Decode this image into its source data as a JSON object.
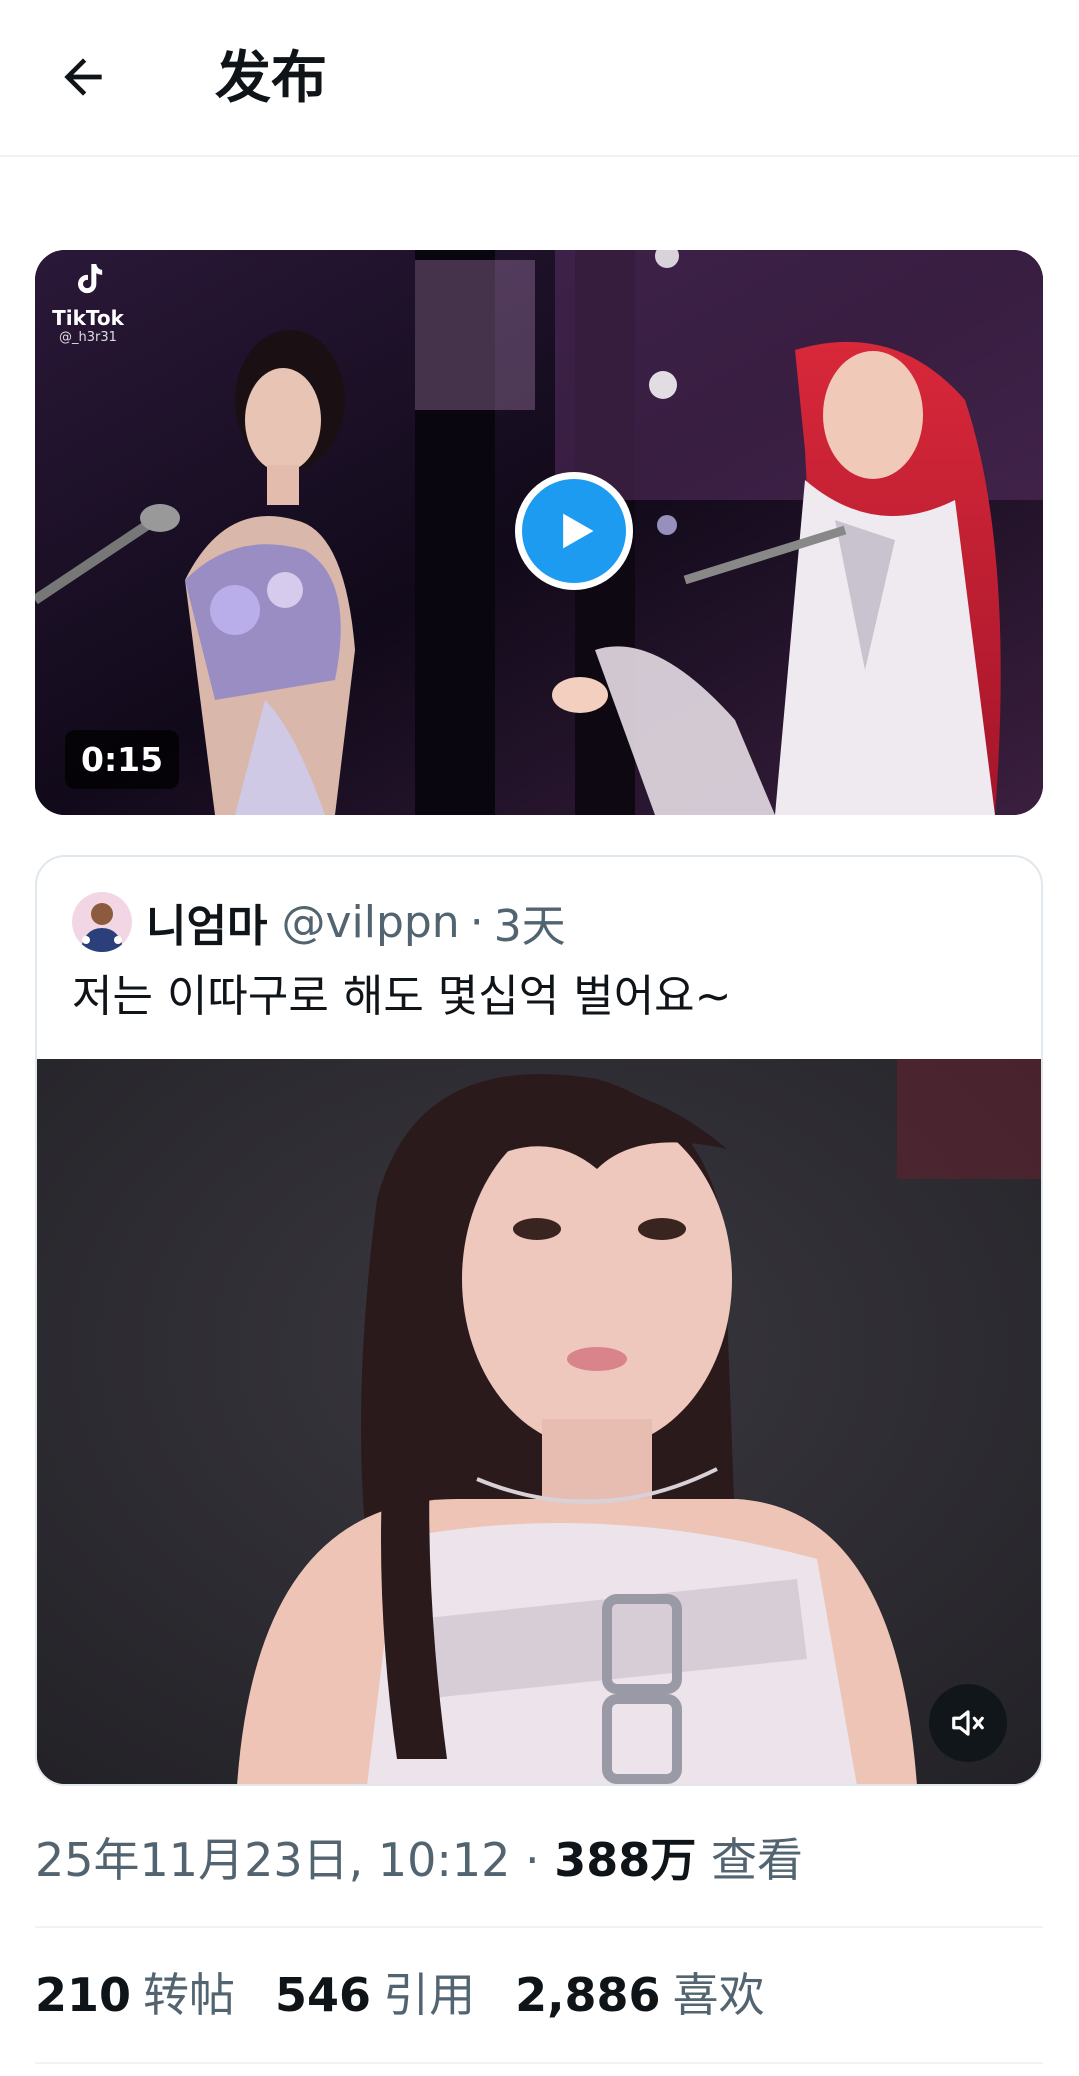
{
  "header": {
    "title": "发布"
  },
  "media": {
    "duration": "0:15",
    "watermark_brand": "TikTok",
    "watermark_user": "@_h3r31"
  },
  "quote": {
    "name": "니엄마",
    "handle": "@vilppn",
    "separator": "·",
    "time": "3天",
    "text": "저는 이따구로 해도 몇십억 벌어요~"
  },
  "meta": {
    "datetime": "25年11月23日, 10:12",
    "separator": "·",
    "views_count": "388万",
    "views_label": "查看"
  },
  "stats": {
    "reposts_count": "210",
    "reposts_label": "转帖",
    "quotes_count": "546",
    "quotes_label": "引用",
    "likes_count": "2,886",
    "likes_label": "喜欢"
  },
  "colors": {
    "accent": "#1d9bf0",
    "secondary_text": "#536471",
    "primary_text": "#0f1419"
  },
  "icons": [
    "back-arrow-icon",
    "play-icon",
    "tiktok-logo-icon",
    "mute-icon"
  ]
}
